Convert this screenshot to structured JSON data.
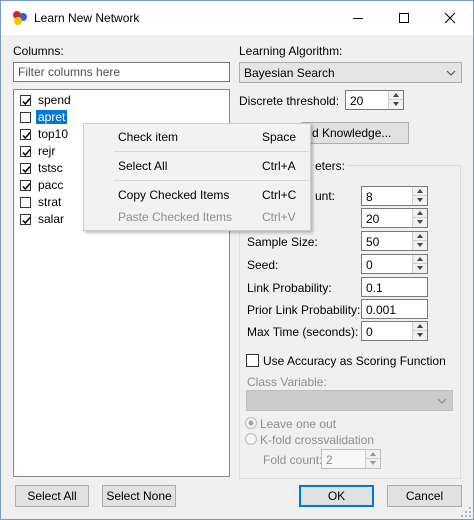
{
  "window": {
    "title": "Learn New Network",
    "icon": "bayes-network-app-icon"
  },
  "columns": {
    "label": "Columns:",
    "filter_placeholder": "Filter columns here",
    "items": [
      {
        "label": "spend",
        "checked": true,
        "selected": false
      },
      {
        "label": "apret",
        "checked": false,
        "selected": true
      },
      {
        "label": "top10",
        "checked": true,
        "selected": false
      },
      {
        "label": "rejr",
        "checked": true,
        "selected": false
      },
      {
        "label": "tstsc",
        "checked": true,
        "selected": false
      },
      {
        "label": "pacc",
        "checked": true,
        "selected": false
      },
      {
        "label": "strat",
        "checked": false,
        "selected": false
      },
      {
        "label": "salar",
        "checked": true,
        "selected": false
      }
    ]
  },
  "context_menu": {
    "items": [
      {
        "label": "Check item",
        "shortcut": "Space",
        "enabled": true
      },
      {
        "label": "Select All",
        "shortcut": "Ctrl+A",
        "enabled": true
      },
      {
        "label": "Copy Checked Items",
        "shortcut": "Ctrl+C",
        "enabled": true
      },
      {
        "label": "Paste Checked Items",
        "shortcut": "Ctrl+V",
        "enabled": false
      }
    ]
  },
  "algorithm": {
    "label": "Learning Algorithm:",
    "selected": "Bayesian Search"
  },
  "discrete_threshold": {
    "label": "Discrete threshold:",
    "value": "20"
  },
  "background_knowledge_button": "d Knowledge...",
  "parameters": {
    "group_label": "eters:",
    "fields": [
      {
        "label": "unt:",
        "value": "8"
      },
      {
        "label": "",
        "value": "20"
      },
      {
        "label": "Sample Size:",
        "value": "50"
      },
      {
        "label": "Seed:",
        "value": "0"
      },
      {
        "label": "Link Probability:",
        "value": "0.1"
      },
      {
        "label": "Prior Link Probability:",
        "value": "0.001"
      },
      {
        "label": "Max Time (seconds):",
        "value": "0"
      }
    ],
    "use_accuracy": {
      "label": "Use Accuracy as Scoring Function",
      "checked": false
    },
    "class_variable_label": "Class Variable:",
    "class_variable_value": "",
    "leave_one_out": "Leave one out",
    "kfold": "K-fold crossvalidation",
    "fold_count_label": "Fold count:",
    "fold_count_value": "2"
  },
  "buttons": {
    "select_all": "Select All",
    "select_none": "Select None",
    "ok": "OK",
    "cancel": "Cancel"
  },
  "colors": {
    "selection": "#0078d7",
    "window_bg": "#f0f0f0"
  }
}
